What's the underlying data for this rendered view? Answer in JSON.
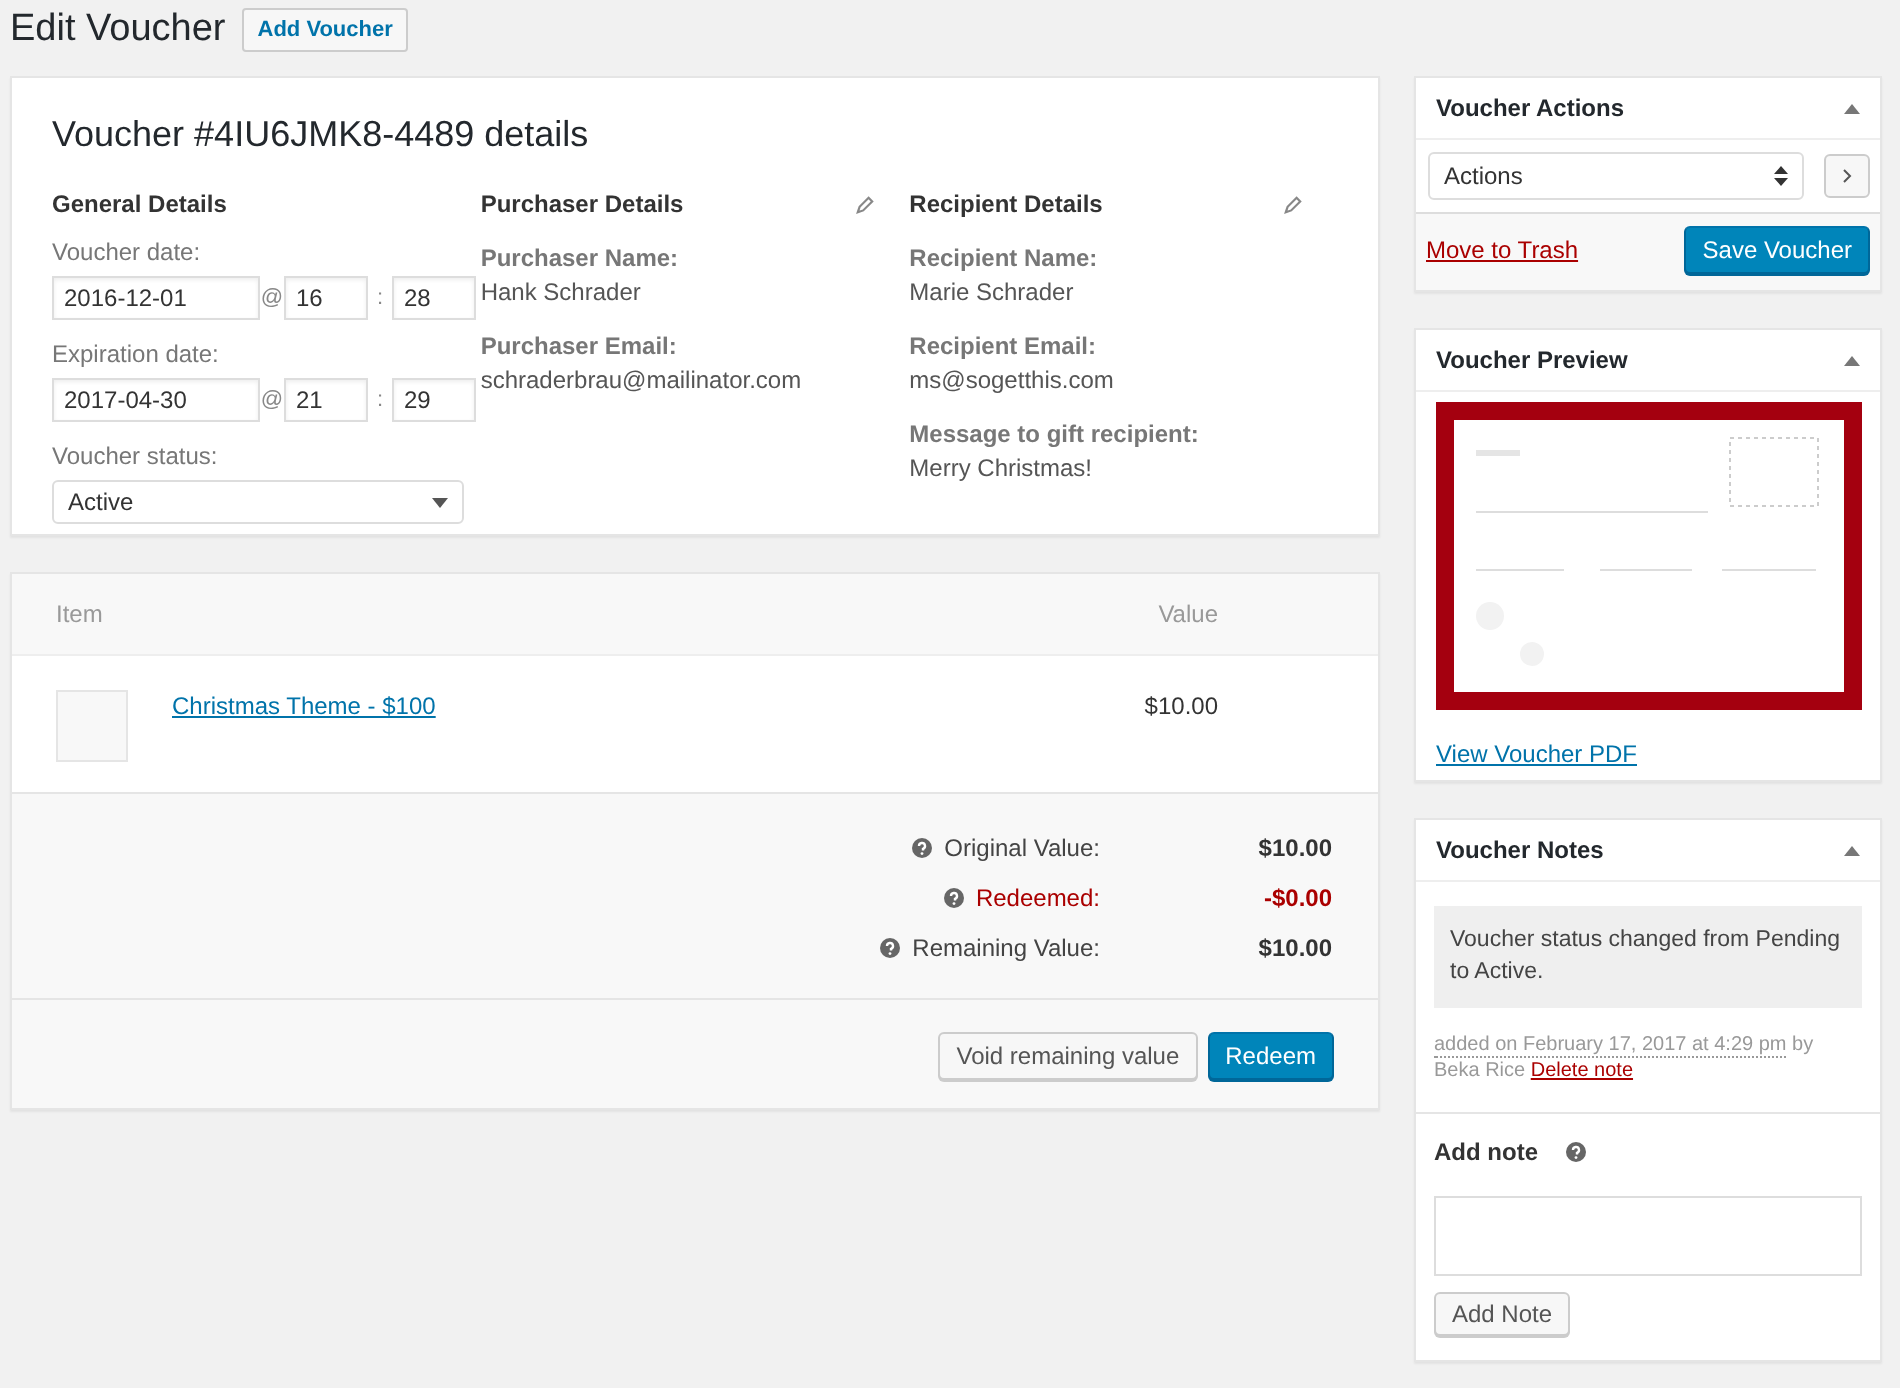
{
  "page": {
    "title": "Edit Voucher",
    "add_button": "Add Voucher"
  },
  "details": {
    "title": "Voucher #4IU6JMK8-4489 details",
    "general": {
      "heading": "General Details",
      "voucher_date_label": "Voucher date:",
      "voucher_date": "2016-12-01",
      "voucher_hour": "16",
      "voucher_minute": "28",
      "expiration_label": "Expiration date:",
      "expiration_date": "2017-04-30",
      "expiration_hour": "21",
      "expiration_minute": "29",
      "at": "@",
      "colon": ":",
      "status_label": "Voucher status:",
      "status": "Active"
    },
    "purchaser": {
      "heading": "Purchaser Details",
      "fields": [
        {
          "label": "Purchaser Name:",
          "value": "Hank Schrader"
        },
        {
          "label": "Purchaser Email:",
          "value": "schraderbrau@mailinator.com"
        }
      ]
    },
    "recipient": {
      "heading": "Recipient Details",
      "fields": [
        {
          "label": "Recipient Name:",
          "value": "Marie Schrader"
        },
        {
          "label": "Recipient Email:",
          "value": "ms@sogetthis.com"
        },
        {
          "label": "Message to gift recipient:",
          "value": "Merry Christmas!"
        }
      ]
    }
  },
  "items": {
    "columns": [
      "Item",
      "Value"
    ],
    "rows": [
      {
        "name": "Christmas Theme - $100",
        "value": "$10.00"
      }
    ],
    "totals": [
      {
        "label": "Original Value:",
        "value": "$10.00",
        "kind": "normal"
      },
      {
        "label": "Redeemed:",
        "value": "-$0.00",
        "kind": "negative"
      },
      {
        "label": "Remaining Value:",
        "value": "$10.00",
        "kind": "normal"
      }
    ],
    "buttons": [
      "Void remaining value",
      "Redeem"
    ]
  },
  "actions": {
    "title": "Voucher Actions",
    "select": "Actions",
    "trash": "Move to Trash",
    "save": "Save Voucher"
  },
  "preview": {
    "title": "Voucher Preview",
    "link": "View Voucher PDF"
  },
  "notes": {
    "title": "Voucher Notes",
    "items": [
      {
        "text": "Voucher status changed from Pending to Active.",
        "meta": "added on February 17, 2017 at 4:29 pm",
        "by": "by Beka Rice",
        "delete": "Delete note"
      }
    ],
    "add_label": "Add note",
    "add_button": "Add Note"
  }
}
